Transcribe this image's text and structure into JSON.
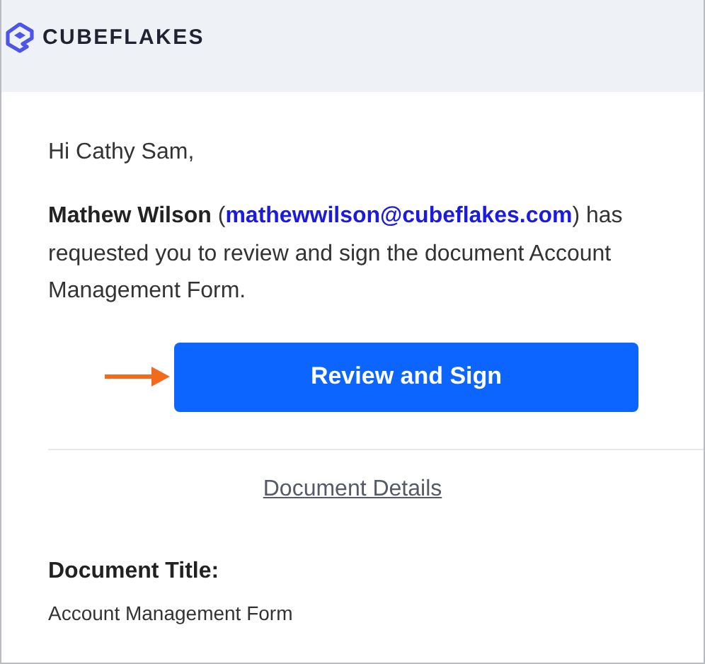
{
  "header": {
    "logo_text": "CUBEFLAKES"
  },
  "greeting": "Hi Cathy Sam,",
  "message": {
    "before_link": "**Mathew Wilson** (",
    "link": "mathewwilson@cubeflakes.com",
    "after_link": ") has requested you to review and sign the document Account Management Form."
  },
  "action_button": {
    "label": "Review and Sign"
  },
  "details_link": "Document Details",
  "fields": [
    {
      "label": "Document Title:",
      "value": "Account Management Form"
    }
  ]
}
